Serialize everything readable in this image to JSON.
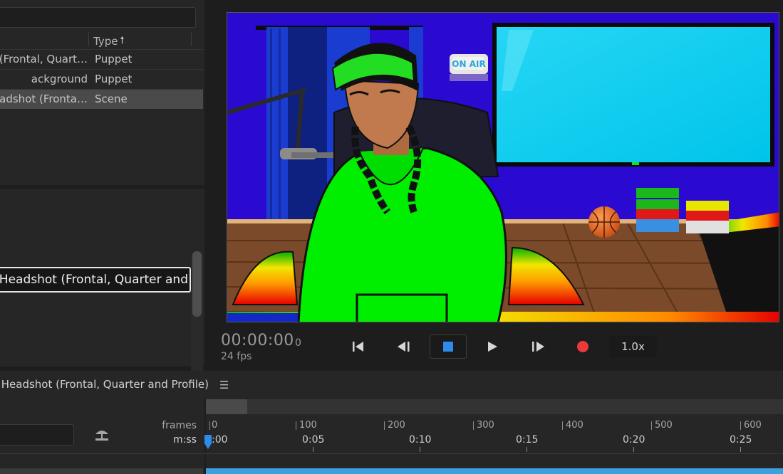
{
  "project": {
    "type_header": "Type",
    "rows": [
      {
        "name": "(Frontal, Quart…",
        "type": "Puppet"
      },
      {
        "name": "ackground",
        "type": "Puppet"
      },
      {
        "name": "eadshot (Fronta…",
        "type": "Scene"
      }
    ]
  },
  "properties": {
    "name_value": "s Headshot (Frontal, Quarter and"
  },
  "stage": {
    "on_air_sign": "ON AIR"
  },
  "transport": {
    "timecode": "00:00:00",
    "frame": "0",
    "fps": "24 fps",
    "speed": "1.0x"
  },
  "timeline": {
    "title": "s Headshot (Frontal, Quarter and Profile)",
    "frames_label": "frames",
    "mss_label": "m:ss",
    "frame_ticks": [
      "0",
      "100",
      "200",
      "300",
      "400",
      "500",
      "600"
    ],
    "time_ticks": [
      ":00",
      "0:05",
      "0:10",
      "0:15",
      "0:20",
      "0:25"
    ]
  },
  "colors": {
    "accent": "#2d8ceb",
    "record": "#ea3a3a",
    "track": "#3aa0de"
  }
}
